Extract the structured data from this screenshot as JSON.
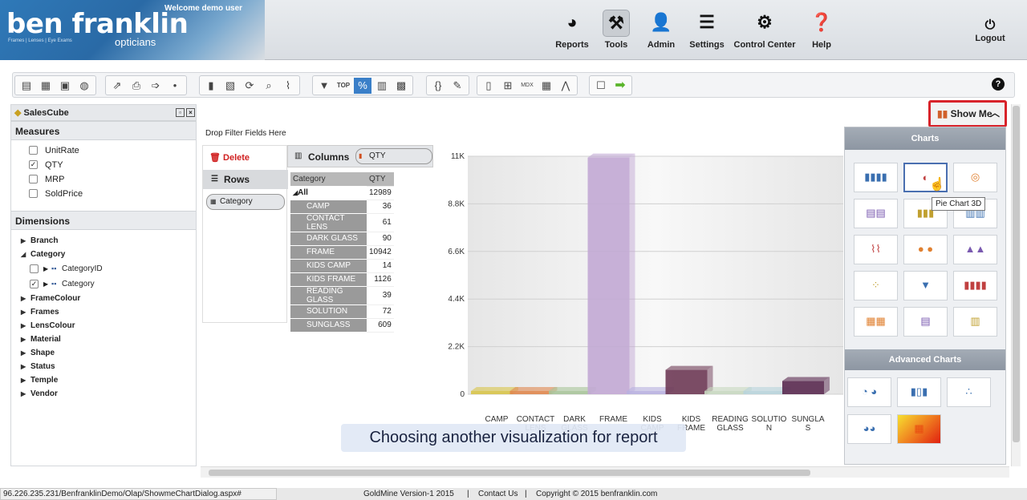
{
  "header": {
    "brand_title": "ben franklin",
    "brand_sub": "opticians",
    "brand_tag": "Frames | Lenses | Eye Exams",
    "welcome": "Welcome  demo user",
    "nav": [
      {
        "label": "Reports",
        "icon": "pie-chart-icon"
      },
      {
        "label": "Tools",
        "icon": "tools-icon"
      },
      {
        "label": "Admin",
        "icon": "user-icon"
      },
      {
        "label": "Settings",
        "icon": "sliders-icon"
      },
      {
        "label": "Control Center",
        "icon": "user-gear-icon"
      },
      {
        "label": "Help",
        "icon": "help-icon"
      }
    ],
    "logout": "Logout"
  },
  "cube": {
    "name": "SalesCube"
  },
  "measures": {
    "title": "Measures",
    "items": [
      {
        "label": "UnitRate",
        "checked": false
      },
      {
        "label": "QTY",
        "checked": true
      },
      {
        "label": "MRP",
        "checked": false
      },
      {
        "label": "SoldPrice",
        "checked": false
      }
    ]
  },
  "dimensions": {
    "title": "Dimensions",
    "items": [
      "Branch",
      "Category",
      "FrameColour",
      "Frames",
      "LensColour",
      "Material",
      "Shape",
      "Status",
      "Temple",
      "Vendor"
    ],
    "category_children": [
      {
        "label": "CategoryID",
        "checked": false
      },
      {
        "label": "Category",
        "checked": true
      }
    ]
  },
  "pivot": {
    "drop_filter": "Drop Filter Fields Here",
    "delete": "Delete",
    "rows": "Rows",
    "row_field": "Category",
    "columns": "Columns",
    "column_field": "QTY",
    "table_header": [
      "Category",
      "QTY"
    ],
    "all_label": "All",
    "all_value": "12989",
    "rows_data": [
      [
        "CAMP",
        "36"
      ],
      [
        "CONTACT LENS",
        "61"
      ],
      [
        "DARK GLASS",
        "90"
      ],
      [
        "FRAME",
        "10942"
      ],
      [
        "KIDS CAMP",
        "14"
      ],
      [
        "KIDS FRAME",
        "1126"
      ],
      [
        "READING GLASS",
        "39"
      ],
      [
        "SOLUTION",
        "72"
      ],
      [
        "SUNGLASS",
        "609"
      ]
    ]
  },
  "chart_data": {
    "type": "bar",
    "categories": [
      "CAMP",
      "CONTACT LENS",
      "DARK GLASS",
      "FRAME",
      "KIDS CAMP",
      "KIDS FRAME",
      "READING GLASS",
      "SOLUTION",
      "SUNGLASS"
    ],
    "category_labels": [
      [
        "CAMP"
      ],
      [
        "CONTACT",
        "LENS"
      ],
      [
        "DARK",
        "GLASS"
      ],
      [
        "FRAME"
      ],
      [
        "KIDS",
        "CAMP"
      ],
      [
        "KIDS",
        "FRAME"
      ],
      [
        "READING",
        "GLASS"
      ],
      [
        "SOLUTIO",
        "N"
      ],
      [
        "SUNGLA",
        "S"
      ]
    ],
    "values": [
      36,
      61,
      90,
      10942,
      14,
      1126,
      39,
      72,
      609
    ],
    "colors": [
      "#d8c44a",
      "#e0874e",
      "#a8c49a",
      "#c2a8d4",
      "#b8b0e0",
      "#6e3a55",
      "#c8d8c0",
      "#b8d4dc",
      "#5a2a50"
    ],
    "yticks": [
      "0",
      "2.2K",
      "4.4K",
      "6.6K",
      "8.8K",
      "11K"
    ],
    "ylim": [
      0,
      11000
    ]
  },
  "show_me": {
    "label": "Show Me"
  },
  "charts_panel": {
    "title": "Charts",
    "advanced_title": "Advanced Charts",
    "tooltip": "Pie Chart 3D"
  },
  "caption": "Choosing another visualization for report",
  "footer": {
    "url": "96.226.235.231/BenfranklinDemo/Olap/ShowmeChartDialog.aspx#",
    "version": "GoldMine Version-1 2015",
    "contact": "Contact Us",
    "copyright": "Copyright © 2015 benfranklin.com"
  }
}
